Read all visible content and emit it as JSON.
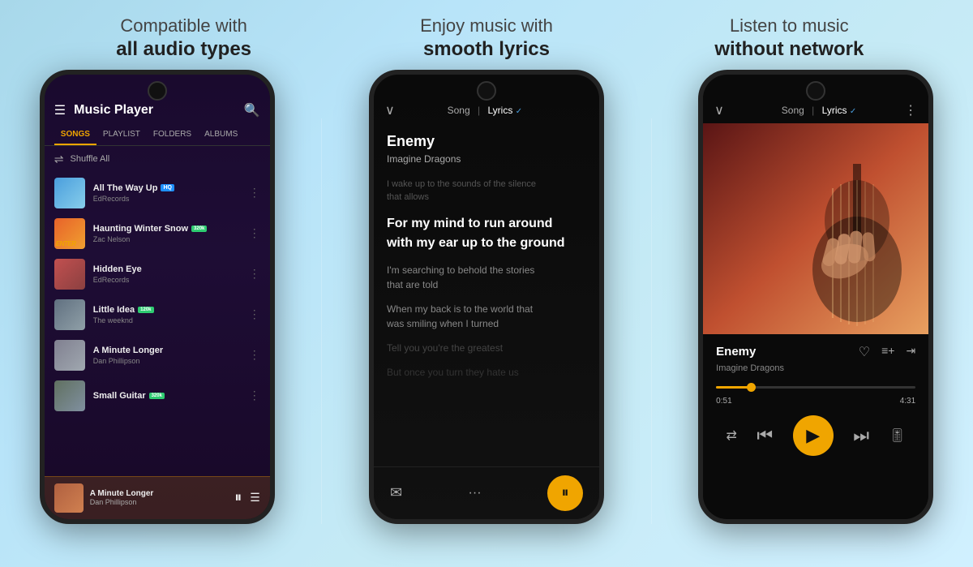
{
  "headlines": [
    {
      "light": "Compatible with",
      "bold": "all audio types"
    },
    {
      "light": "Enjoy music with",
      "bold": "smooth lyrics"
    },
    {
      "light": "Listen to music",
      "bold": "without network"
    }
  ],
  "phone1": {
    "title": "Music Player",
    "tabs": [
      "SONGS",
      "PLAYLIST",
      "FOLDERS",
      "ALBUMS"
    ],
    "active_tab": "SONGS",
    "shuffle_label": "Shuffle All",
    "songs": [
      {
        "name": "All The Way Up",
        "artist": "EdRecords",
        "quality": "HQ",
        "quality_type": "hq",
        "thumb": "sky"
      },
      {
        "name": "Haunting Winter Snow",
        "artist": "Zac Nelson",
        "quality": "320k",
        "quality_type": "kbps",
        "thumb": "orange"
      },
      {
        "name": "Hidden Eye",
        "artist": "EdRecords",
        "quality": "",
        "quality_type": "",
        "thumb": "face"
      },
      {
        "name": "Little Idea",
        "artist": "The weeknd",
        "quality": "120k",
        "quality_type": "kbps",
        "thumb": "tree"
      },
      {
        "name": "A Minute Longer",
        "artist": "Dan Phillipson",
        "quality": "",
        "quality_type": "",
        "thumb": "mountain"
      },
      {
        "name": "Small Guitar",
        "artist": "",
        "quality": "320k",
        "quality_type": "kbps",
        "thumb": "guitar"
      }
    ],
    "now_playing": {
      "name": "A Minute Longer",
      "artist": "Dan Phillipson"
    }
  },
  "phone2": {
    "nav": {
      "song_label": "Song",
      "lyrics_label": "Lyrics"
    },
    "song": {
      "title": "Enemy",
      "artist": "Imagine Dragons"
    },
    "lyrics": [
      {
        "text": "I wake up to the sounds of the silence that allows",
        "state": "past"
      },
      {
        "text": "For my mind to run around with my ear up to the ground",
        "state": "active"
      },
      {
        "text": "I'm searching to behold the stories that are told",
        "state": "near"
      },
      {
        "text": "When my back is to the world that was smiling when I turned",
        "state": "near"
      },
      {
        "text": "Tell you you're the greatest",
        "state": "dim"
      },
      {
        "text": "But once you turn they hate us",
        "state": "dim"
      }
    ]
  },
  "phone3": {
    "nav": {
      "song_label": "Song",
      "lyrics_label": "Lyrics"
    },
    "song": {
      "title": "Enemy",
      "artist": "Imagine Dragons"
    },
    "time_current": "0:51",
    "time_total": "4:31",
    "progress_percent": 18
  }
}
